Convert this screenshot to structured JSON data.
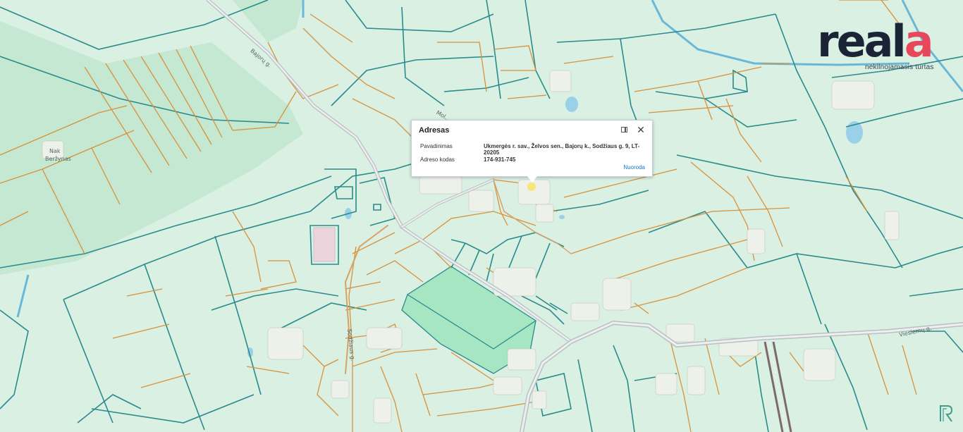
{
  "brand": {
    "name_main": "real",
    "name_accent": "a",
    "tagline": "nekilnojamasis turtas",
    "accent_color": "#e8465a",
    "text_color": "#1b2437"
  },
  "map": {
    "land_color": "#d9f0e3",
    "parcel_border_color": "#2a8a8c",
    "boundary_line_color": "#d9913a",
    "road_color": "#b9bfc4",
    "highlight_color": "#9fe3bd",
    "water_color": "#9ad0e8",
    "street_labels": [
      "Bajorų g.",
      "Mol...",
      "Sodžiaus g.",
      "Viesiemų g."
    ],
    "place_labels": [
      "Nak",
      "Beržynas"
    ]
  },
  "popup": {
    "title": "Adresas",
    "rows": [
      {
        "key": "Pavadinimas",
        "value": "Ukmergės r. sav., Želvos sen., Bajorų k., Sodžiaus g. 9, LT-20205"
      },
      {
        "key": "Adreso kodas",
        "value": "174-931-745"
      }
    ],
    "link_label": "Nuoroda",
    "dock_icon": "dock-icon",
    "close_icon": "close-icon"
  },
  "corner_logo": "reala-corner-icon"
}
